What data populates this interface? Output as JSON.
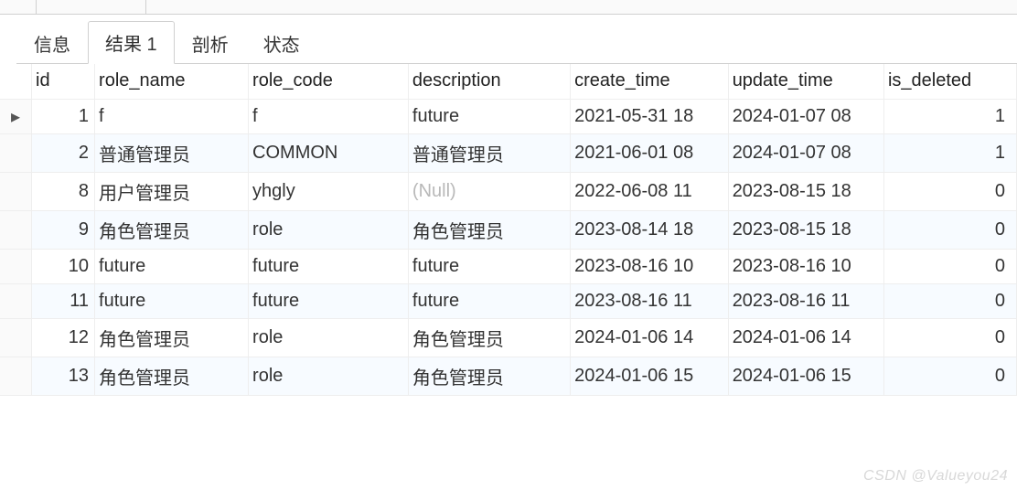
{
  "tabs": {
    "info": "信息",
    "result": "结果 1",
    "profile": "剖析",
    "status": "状态"
  },
  "columns": {
    "id": "id",
    "role_name": "role_name",
    "role_code": "role_code",
    "description": "description",
    "create_time": "create_time",
    "update_time": "update_time",
    "is_deleted": "is_deleted"
  },
  "null_label": "(Null)",
  "current_row_marker": "▸",
  "rows": [
    {
      "id": "1",
      "role_name": "f",
      "role_code": "f",
      "description": "future",
      "create_time": "2021-05-31 18",
      "update_time": "2024-01-07 08",
      "is_deleted": "1",
      "current": true
    },
    {
      "id": "2",
      "role_name": "普通管理员",
      "role_code": "COMMON",
      "description": "普通管理员",
      "create_time": "2021-06-01 08",
      "update_time": "2024-01-07 08",
      "is_deleted": "1"
    },
    {
      "id": "8",
      "role_name": "用户管理员",
      "role_code": "yhgly",
      "description": null,
      "create_time": "2022-06-08 11",
      "update_time": "2023-08-15 18",
      "is_deleted": "0"
    },
    {
      "id": "9",
      "role_name": "角色管理员",
      "role_code": "role",
      "description": "角色管理员",
      "create_time": "2023-08-14 18",
      "update_time": "2023-08-15 18",
      "is_deleted": "0"
    },
    {
      "id": "10",
      "role_name": "future",
      "role_code": "future",
      "description": "future",
      "create_time": "2023-08-16 10",
      "update_time": "2023-08-16 10",
      "is_deleted": "0"
    },
    {
      "id": "11",
      "role_name": "future",
      "role_code": "future",
      "description": "future",
      "create_time": "2023-08-16 11",
      "update_time": "2023-08-16 11",
      "is_deleted": "0"
    },
    {
      "id": "12",
      "role_name": "角色管理员",
      "role_code": "role",
      "description": "角色管理员",
      "create_time": "2024-01-06 14",
      "update_time": "2024-01-06 14",
      "is_deleted": "0"
    },
    {
      "id": "13",
      "role_name": "角色管理员",
      "role_code": "role",
      "description": "角色管理员",
      "create_time": "2024-01-06 15",
      "update_time": "2024-01-06 15",
      "is_deleted": "0"
    }
  ],
  "watermark": "CSDN @Valueyou24"
}
